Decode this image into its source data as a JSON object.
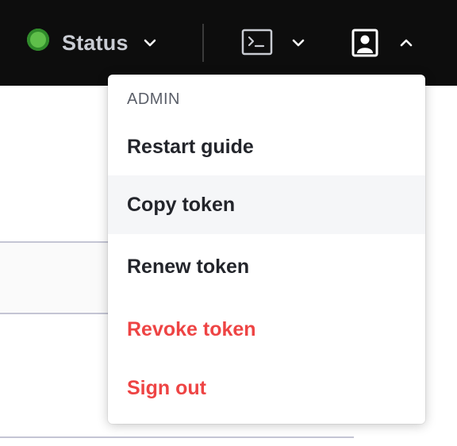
{
  "topbar": {
    "status_label": "Status",
    "status_color": "#5fbf4a",
    "icons": {
      "status_indicator": "status-dot-icon",
      "status_chevron": "chevron-down-icon",
      "terminal": "terminal-icon",
      "terminal_chevron": "chevron-down-icon",
      "user": "user-portrait-icon",
      "user_chevron": "chevron-up-icon"
    }
  },
  "user_menu": {
    "section_header": "ADMIN",
    "items": [
      {
        "label": "Restart guide",
        "variant": "default"
      },
      {
        "label": "Copy token",
        "variant": "hovered"
      },
      {
        "label": "Renew token",
        "variant": "default"
      },
      {
        "label": "Revoke token",
        "variant": "danger"
      },
      {
        "label": "Sign out",
        "variant": "danger"
      }
    ],
    "danger_color": "#ee4444",
    "hover_background": "#f5f6f8"
  }
}
